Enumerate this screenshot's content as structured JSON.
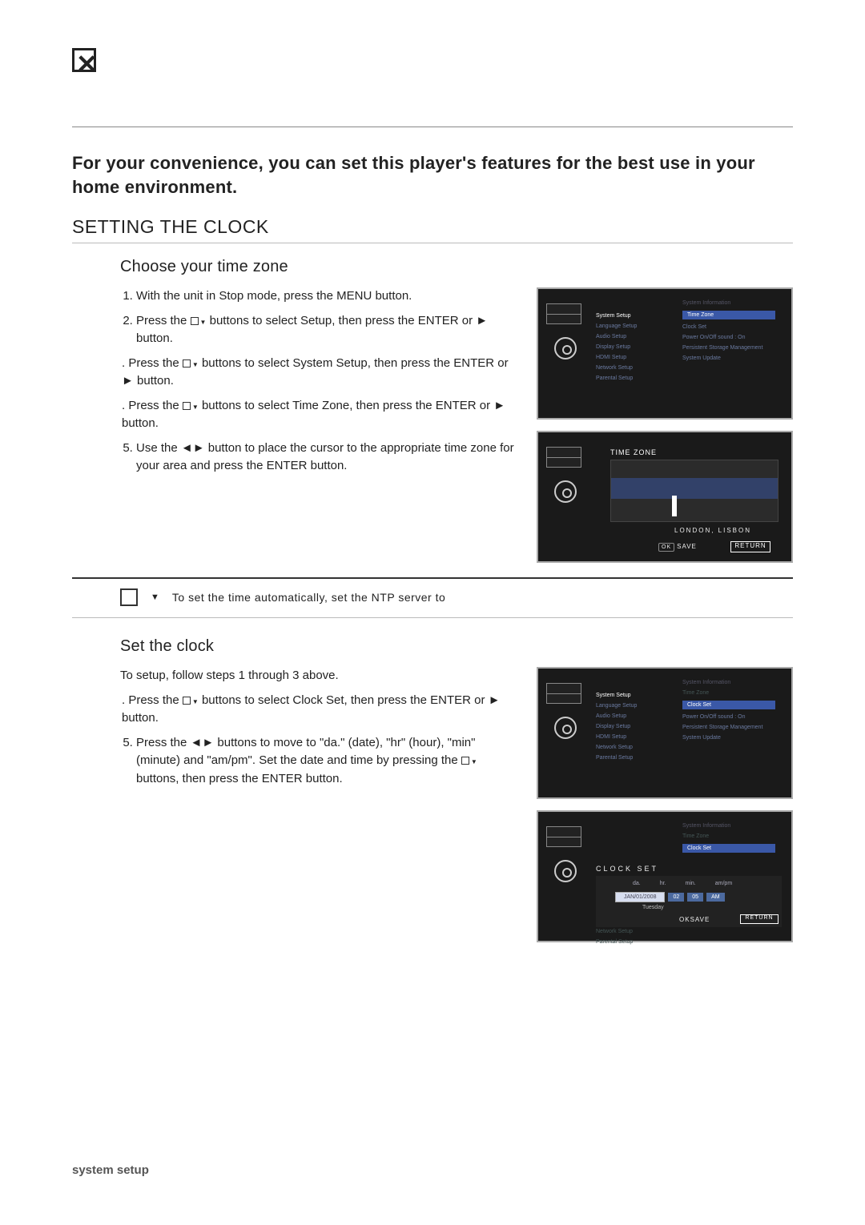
{
  "page": {
    "intro": "For your convenience, you can set this player's features for the best use in your home environment.",
    "section_title": "SETTING THE CLOCK",
    "subsection1": "Choose your time zone",
    "subsection2": "Set the clock",
    "footer": "system setup"
  },
  "steps1": {
    "s1": "With the unit in Stop mode, press the MENU button.",
    "s2a": "Press the ",
    "s2b": " buttons to select Setup, then press the ENTER or ► button.",
    "s3a": "Press the ",
    "s3b": " buttons to select System Setup, then press the ENTER or ► button.",
    "s4a": "Press the ",
    "s4b": " buttons to select Time Zone, then press the ENTER or ► button.",
    "s5": "Use the ◄► button to place the cursor to the appropriate time zone for your area and press the ENTER button."
  },
  "note": {
    "text": "To set the time automatically, set the NTP server to"
  },
  "steps2": {
    "intro": "To setup, follow steps 1 through 3 above.",
    "s4a": "Press the ",
    "s4b": " buttons to select Clock Set, then press the ENTER or ► button.",
    "s5a": "Press the ◄► buttons to move to \"da.\" (date), \"hr\" (hour), \"min\" (minute) and \"am/pm\". Set the date and time by pressing the ",
    "s5b": " buttons, then press the ENTER button."
  },
  "osd1": {
    "right_header": "System Information",
    "left": [
      "System Setup",
      "Language Setup",
      "Audio Setup",
      "Display Setup",
      "HDMI Setup",
      "Network Setup",
      "Parental Setup"
    ],
    "right": [
      "Time Zone",
      "Clock Set",
      "Power On/Off sound     : On",
      "Persistent Storage Management",
      "System Update"
    ]
  },
  "osd2": {
    "title": "TIME ZONE",
    "city": "LONDON, LISBON",
    "save_prefix": "OK",
    "save": "SAVE",
    "return": "RETURN"
  },
  "osd3": {
    "right_header": "System Information",
    "left": [
      "System Setup",
      "Language Setup",
      "Audio Setup",
      "Display Setup",
      "HDMI Setup",
      "Network Setup",
      "Parental Setup"
    ],
    "right_dim_top": "Time Zone",
    "right_hl": "Clock Set",
    "right": [
      "Power On/Off sound     : On",
      "Persistent Storage Management",
      "System Update"
    ]
  },
  "osd4": {
    "right_header": "System Information",
    "right_dim": "Time Zone",
    "hl": "Clock Set",
    "header": "CLOCK SET",
    "labels": {
      "da": "da.",
      "hr": "hr.",
      "min": "min.",
      "ampm": "am/pm"
    },
    "values": {
      "da": "JAN/01/2008",
      "hr": "02",
      "min": "05",
      "ampm": "AM"
    },
    "day": "Tuesday",
    "save_prefix": "OK",
    "save": "SAVE",
    "return": "RETURN"
  }
}
